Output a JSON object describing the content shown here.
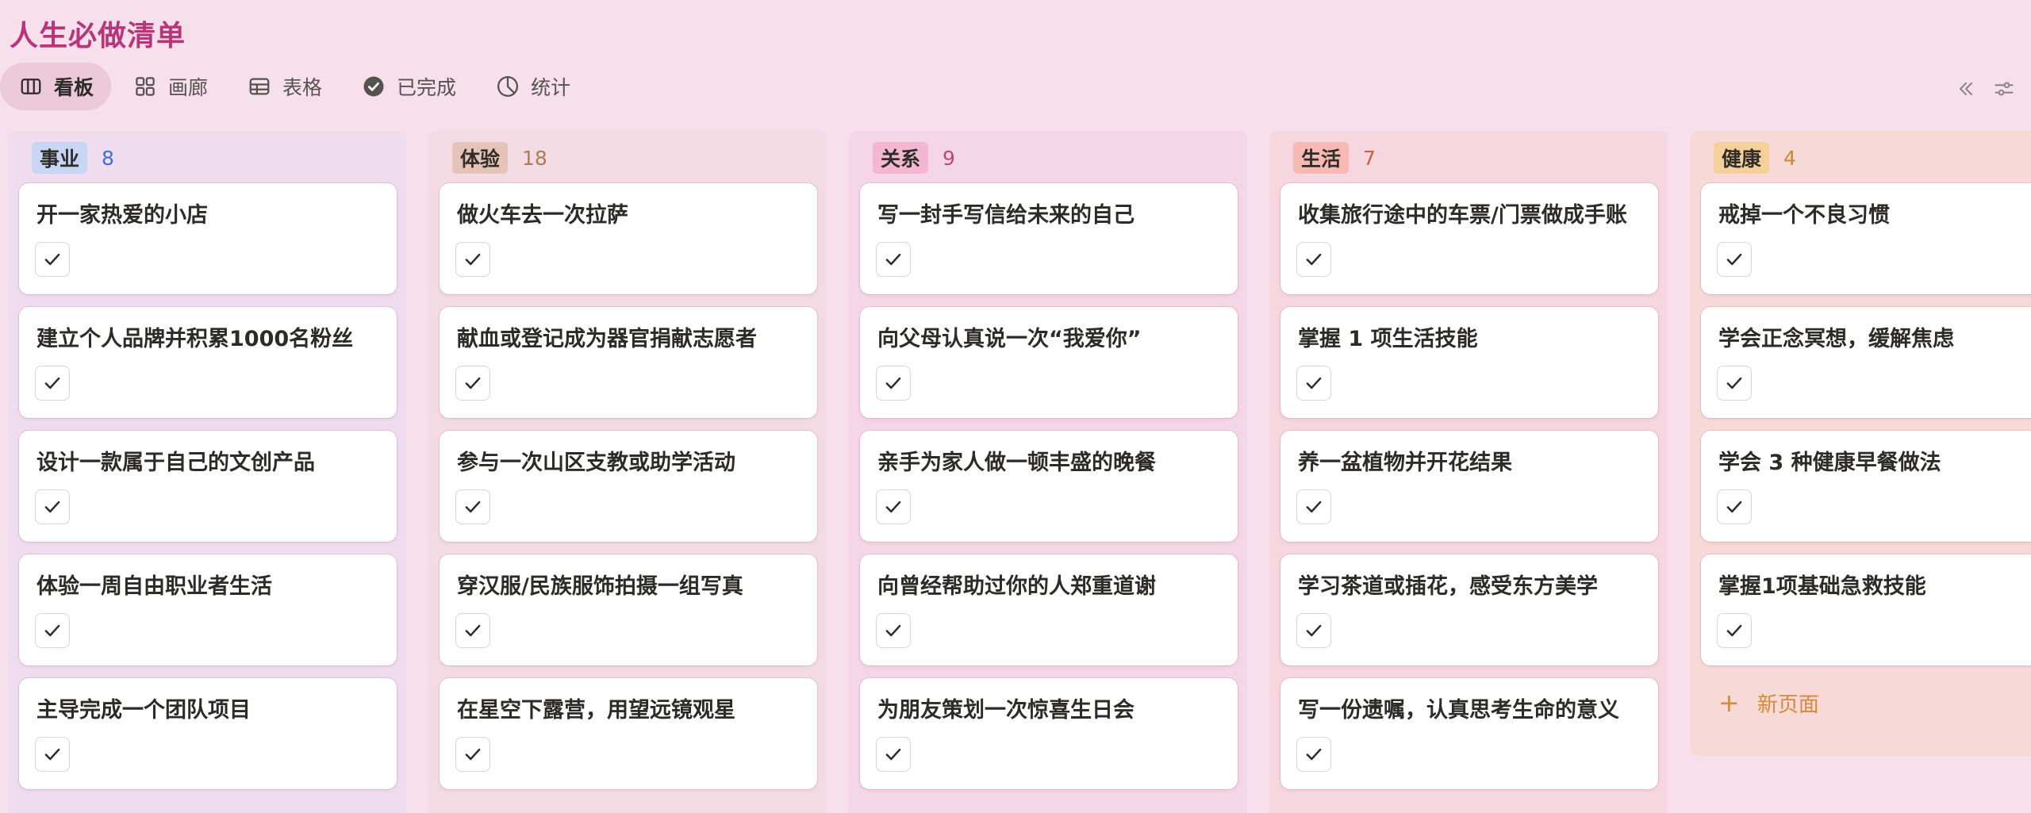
{
  "page_title": "人生必做清单",
  "views": [
    {
      "label": "看板",
      "icon": "board-icon",
      "active": true
    },
    {
      "label": "画廊",
      "icon": "gallery-icon",
      "active": false
    },
    {
      "label": "表格",
      "icon": "table-icon",
      "active": false
    },
    {
      "label": "已完成",
      "icon": "check-circle-icon",
      "active": false
    },
    {
      "label": "统计",
      "icon": "pie-chart-icon",
      "active": false
    }
  ],
  "toolbar_icons": [
    "collapse-double-chevron-icon",
    "filter-sliders-icon"
  ],
  "columns": [
    {
      "name": "事业",
      "count": "8",
      "colors": {
        "bg": "#efdcef",
        "tag": "#c8d6f4",
        "count": "#3f6fd8"
      },
      "cards": [
        "开一家热爱的小店",
        "建立个人品牌并积累1000名粉丝",
        "设计一款属于自己的文创产品",
        "体验一周自由职业者生活",
        "主导完成一个团队项目"
      ]
    },
    {
      "name": "体验",
      "count": "18",
      "colors": {
        "bg": "#f3dbe4",
        "tag": "#e6c3b8",
        "count": "#b07a50"
      },
      "cards": [
        "做火车去一次拉萨",
        "献血或登记成为器官捐献志愿者",
        "参与一次山区支教或助学活动",
        "穿汉服/民族服饰拍摄一组写真",
        "在星空下露营，用望远镜观星"
      ]
    },
    {
      "name": "关系",
      "count": "9",
      "colors": {
        "bg": "#f5d6e6",
        "tag": "#f3b7d2",
        "count": "#c2457e"
      },
      "cards": [
        "写一封手写信给未来的自己",
        "向父母认真说一次“我爱你”",
        "亲手为家人做一顿丰盛的晚餐",
        "向曾经帮助过你的人郑重道谢",
        "为朋友策划一次惊喜生日会"
      ]
    },
    {
      "name": "生活",
      "count": "7",
      "colors": {
        "bg": "#f6d6df",
        "tag": "#f6b9b3",
        "count": "#d0603e"
      },
      "cards": [
        "收集旅行途中的车票/门票做成手账",
        "掌握 1 项生活技能",
        "养一盆植物并开花结果",
        "学习茶道或插花，感受东方美学",
        "写一份遗嘱，认真思考生命的意义"
      ]
    },
    {
      "name": "健康",
      "count": "4",
      "colors": {
        "bg": "#f7d9d8",
        "tag": "#f6d09a",
        "count": "#c98a22"
      },
      "cards": [
        "戒掉一个不良习惯",
        "学会正念冥想，缓解焦虑",
        "学会 3 种健康早餐做法",
        "掌握1项基础急救技能"
      ],
      "new_page_label": "新页面"
    }
  ]
}
